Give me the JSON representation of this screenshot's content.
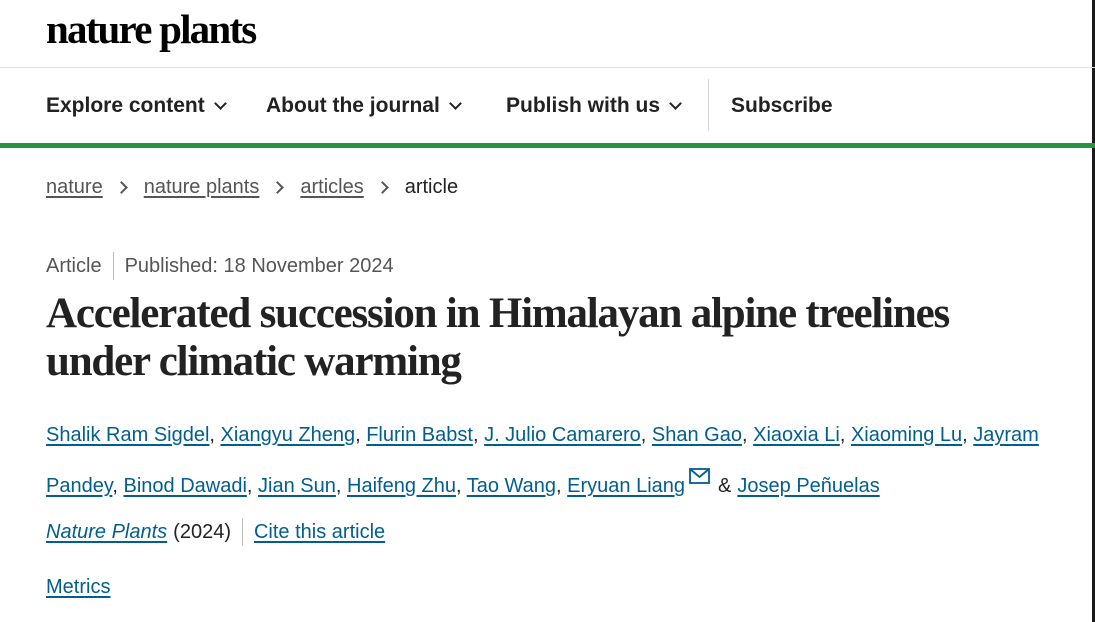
{
  "header": {
    "logo": "nature plants"
  },
  "nav": {
    "explore": "Explore content",
    "about": "About the journal",
    "publish": "Publish with us",
    "subscribe": "Subscribe"
  },
  "breadcrumb": [
    "nature",
    "nature plants",
    "articles",
    "article"
  ],
  "article": {
    "type": "Article",
    "published": "Published: 18 November 2024",
    "title": "Accelerated succession in Himalayan alpine treelines under climatic warming",
    "authors": [
      "Shalik Ram Sigdel",
      "Xiangyu Zheng",
      "Flurin Babst",
      "J. Julio Camarero",
      "Shan Gao",
      "Xiaoxia Li",
      "Xiaoming Lu",
      "Jayram Pandey",
      "Binod Dawadi",
      "Jian Sun",
      "Haifeng Zhu",
      "Tao Wang",
      "Eryuan Liang",
      "Josep Peñuelas"
    ],
    "author_separator": ",",
    "last_author_separator": "&",
    "corresponding_icon": "mail-icon",
    "journal": "Nature Plants",
    "year": "(2024)",
    "cite_label": "Cite this article",
    "metrics_label": "Metrics"
  },
  "colors": {
    "accent": "#2a9341",
    "link": "#025e8d"
  }
}
